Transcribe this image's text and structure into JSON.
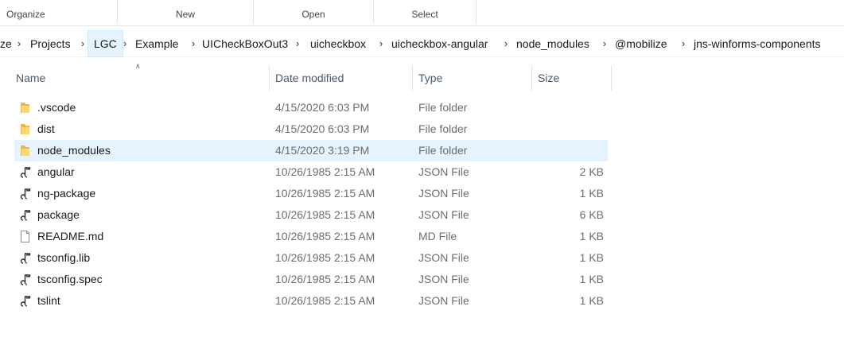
{
  "ribbon": {
    "groups": [
      "Organize",
      "New",
      "Open",
      "Select"
    ]
  },
  "breadcrumb": {
    "items": [
      "ze",
      "Projects",
      "LGC",
      "Example",
      "UICheckBoxOut3",
      "uicheckbox",
      "uicheckbox-angular",
      "node_modules",
      "@mobilize",
      "jns-winforms-components"
    ]
  },
  "columns": {
    "name": "Name",
    "date": "Date modified",
    "type": "Type",
    "size": "Size"
  },
  "files": [
    {
      "name": ".vscode",
      "date": "4/15/2020 6:03 PM",
      "type": "File folder",
      "size": "",
      "icon": "folder-icon"
    },
    {
      "name": "dist",
      "date": "4/15/2020 6:03 PM",
      "type": "File folder",
      "size": "",
      "icon": "folder-icon"
    },
    {
      "name": "node_modules",
      "date": "4/15/2020 3:19 PM",
      "type": "File folder",
      "size": "",
      "icon": "folder-icon"
    },
    {
      "name": "angular",
      "date": "10/26/1985 2:15 AM",
      "type": "JSON File",
      "size": "2 KB",
      "icon": "json-file-icon"
    },
    {
      "name": "ng-package",
      "date": "10/26/1985 2:15 AM",
      "type": "JSON File",
      "size": "1 KB",
      "icon": "json-file-icon"
    },
    {
      "name": "package",
      "date": "10/26/1985 2:15 AM",
      "type": "JSON File",
      "size": "6 KB",
      "icon": "json-file-icon"
    },
    {
      "name": "README.md",
      "date": "10/26/1985 2:15 AM",
      "type": "MD File",
      "size": "1 KB",
      "icon": "document-icon"
    },
    {
      "name": "tsconfig.lib",
      "date": "10/26/1985 2:15 AM",
      "type": "JSON File",
      "size": "1 KB",
      "icon": "json-file-icon"
    },
    {
      "name": "tsconfig.spec",
      "date": "10/26/1985 2:15 AM",
      "type": "JSON File",
      "size": "1 KB",
      "icon": "json-file-icon"
    },
    {
      "name": "tslint",
      "date": "10/26/1985 2:15 AM",
      "type": "JSON File",
      "size": "1 KB",
      "icon": "json-file-icon"
    }
  ],
  "colors": {
    "selection": "#e5f3ff",
    "folder": "#f8d775",
    "header_text": "#4d5a6a",
    "secondary_text": "#6d6d6d"
  }
}
